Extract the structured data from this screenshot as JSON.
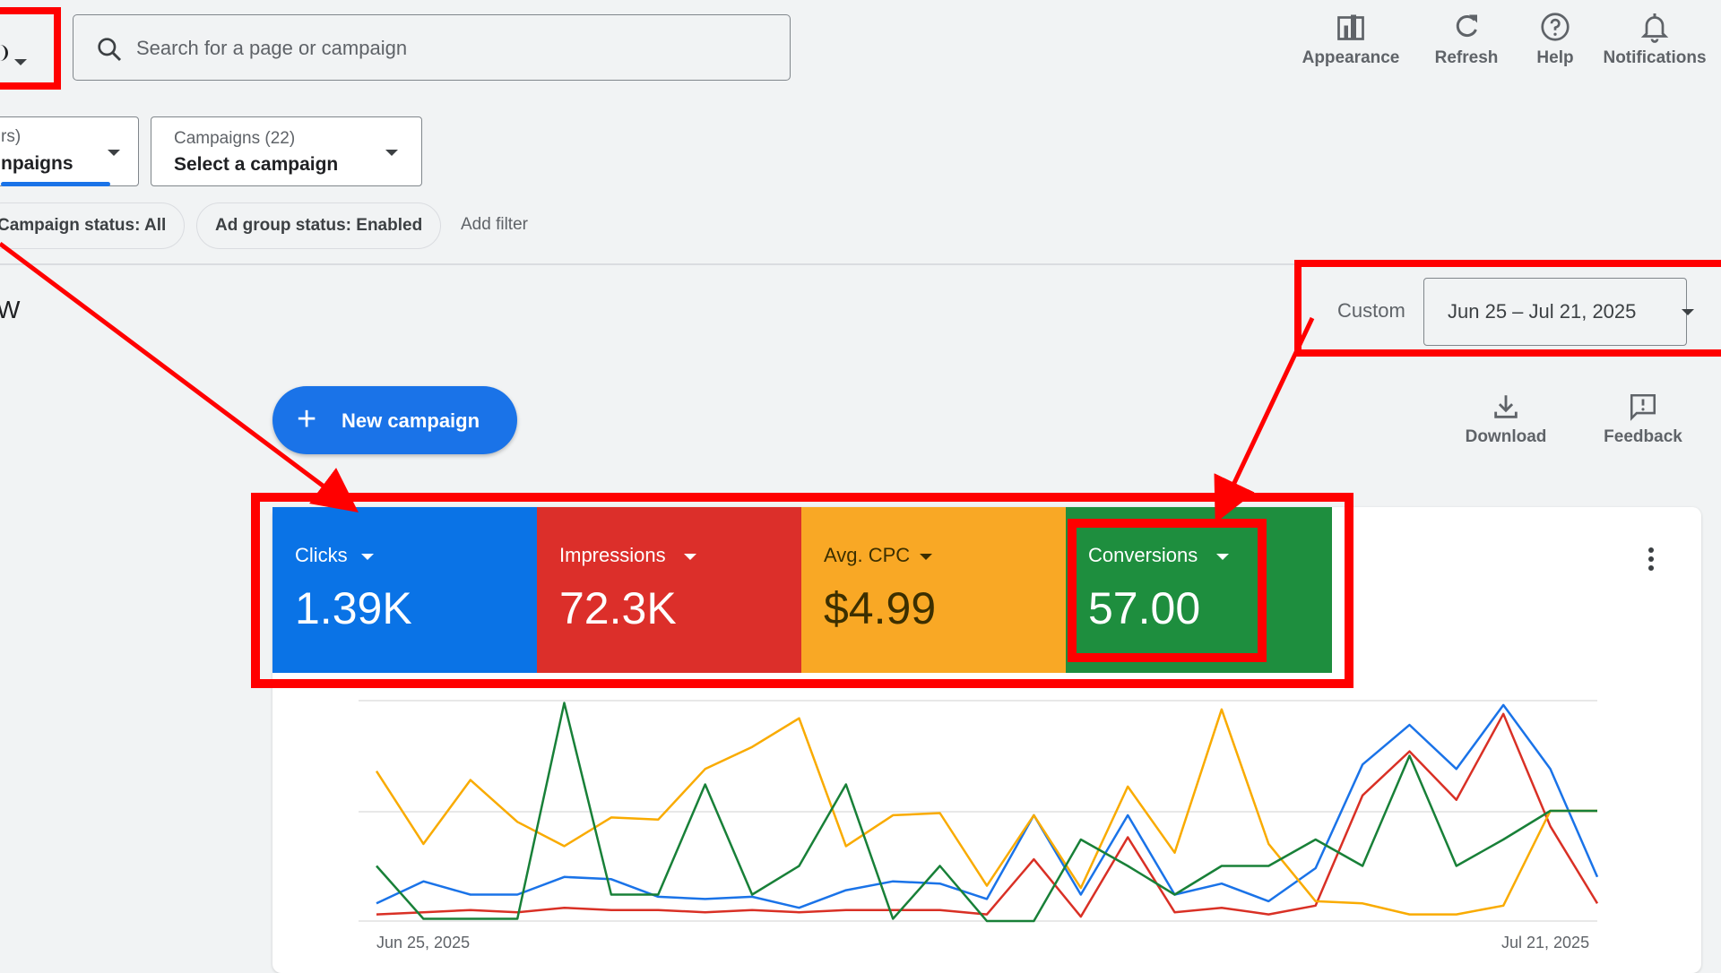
{
  "header": {
    "search_placeholder": "Search for a page or campaign",
    "actions": [
      {
        "label": "Appearance",
        "icon": "appearance-icon"
      },
      {
        "label": "Refresh",
        "icon": "refresh-icon"
      },
      {
        "label": "Help",
        "icon": "help-icon"
      },
      {
        "label": "Notifications",
        "icon": "bell-icon"
      }
    ]
  },
  "selectors": {
    "left": {
      "small": "rs)",
      "big": "npaigns"
    },
    "campaign": {
      "small": "Campaigns (22)",
      "big": "Select a campaign"
    }
  },
  "filters": {
    "chips": [
      "Campaign status: All",
      "Ad group status: Enabled"
    ],
    "add_filter": "Add filter"
  },
  "page_title_fragment": "W",
  "date_range": {
    "preset": "Custom",
    "value": "Jun 25 – Jul 21, 2025"
  },
  "new_campaign_label": "New campaign",
  "tools": {
    "download": "Download",
    "feedback": "Feedback"
  },
  "metrics": [
    {
      "label": "Clicks",
      "value": "1.39K",
      "color": "#0a73e6"
    },
    {
      "label": "Impressions",
      "value": "72.3K",
      "color": "#dc2f2a"
    },
    {
      "label": "Avg. CPC",
      "value": "$4.99",
      "color": "#f9a825"
    },
    {
      "label": "Conversions",
      "value": "57.00",
      "color": "#1e8e3e"
    }
  ],
  "chart_data": {
    "type": "line",
    "x_start_label": "Jun 25, 2025",
    "x_end_label": "Jul 21, 2025",
    "series": [
      {
        "color": "#1a73e8",
        "values": [
          0.08,
          0.18,
          0.12,
          0.12,
          0.2,
          0.19,
          0.11,
          0.1,
          0.11,
          0.06,
          0.14,
          0.18,
          0.17,
          0.1,
          0.48,
          0.12,
          0.48,
          0.12,
          0.17,
          0.09,
          0.24,
          0.71,
          0.89,
          0.69,
          0.98,
          0.69,
          0.2
        ]
      },
      {
        "color": "#d93025",
        "values": [
          0.03,
          0.04,
          0.05,
          0.04,
          0.06,
          0.05,
          0.05,
          0.04,
          0.05,
          0.04,
          0.05,
          0.05,
          0.05,
          0.03,
          0.28,
          0.02,
          0.38,
          0.04,
          0.06,
          0.03,
          0.07,
          0.57,
          0.77,
          0.55,
          0.94,
          0.43,
          0.08
        ]
      },
      {
        "color": "#f9ab00",
        "values": [
          0.68,
          0.35,
          0.64,
          0.45,
          0.34,
          0.47,
          0.46,
          0.69,
          0.79,
          0.92,
          0.34,
          0.48,
          0.49,
          0.16,
          0.48,
          0.15,
          0.61,
          0.31,
          0.96,
          0.35,
          0.09,
          0.08,
          0.03,
          0.03,
          0.07,
          0.5,
          0.5
        ]
      },
      {
        "color": "#188038",
        "values": [
          0.25,
          0.01,
          0.01,
          0.01,
          0.99,
          0.12,
          0.12,
          0.62,
          0.12,
          0.25,
          0.62,
          0.01,
          0.25,
          0.0,
          0.0,
          0.37,
          0.25,
          0.12,
          0.25,
          0.25,
          0.37,
          0.25,
          0.75,
          0.25,
          0.37,
          0.5,
          0.5
        ]
      }
    ]
  }
}
